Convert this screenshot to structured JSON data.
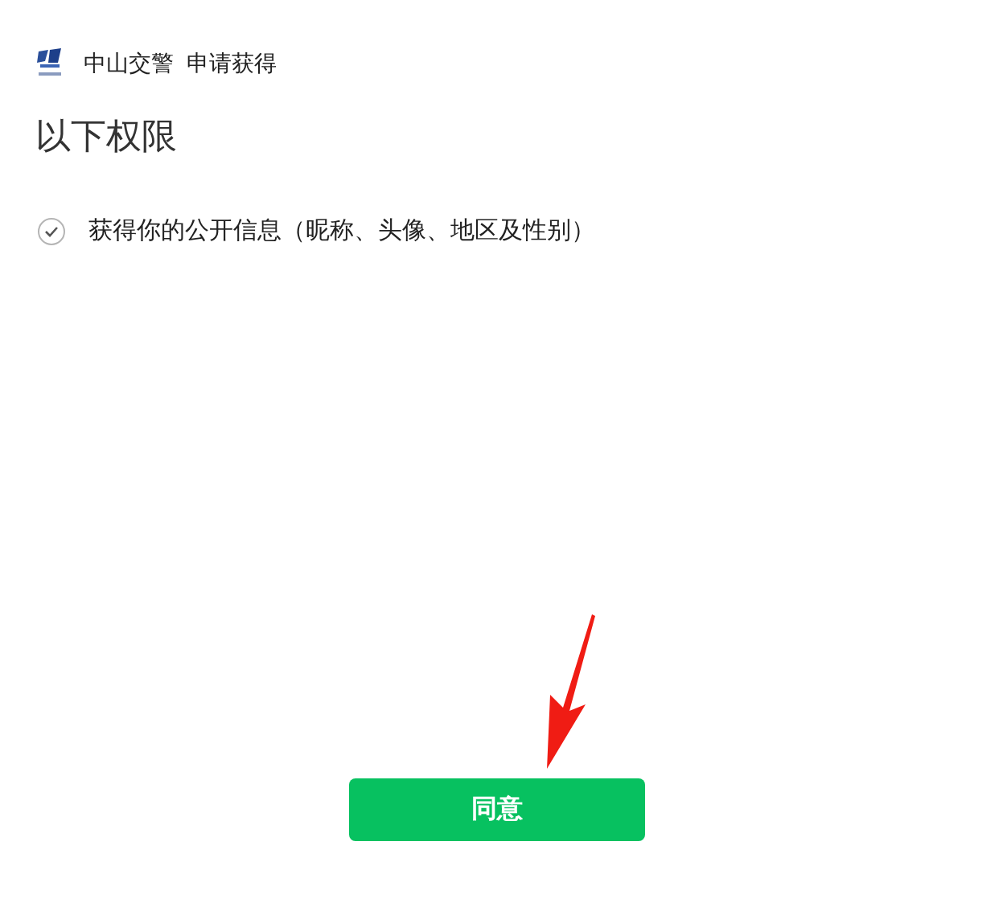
{
  "header": {
    "app_name": "中山交警",
    "request_text": "申请获得"
  },
  "title": "以下权限",
  "permissions": [
    {
      "label": "获得你的公开信息（昵称、头像、地区及性别）",
      "checked": true
    }
  ],
  "button": {
    "label": "同意"
  }
}
